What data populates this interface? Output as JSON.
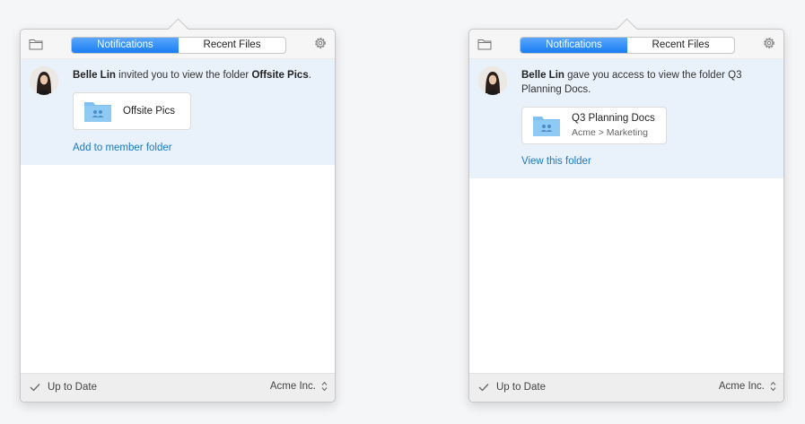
{
  "panels": [
    {
      "tabs": {
        "notifications": "Notifications",
        "recent_files": "Recent Files"
      },
      "notification": {
        "sender": "Belle Lin",
        "message_pre": " invited you to view the folder ",
        "folder_name": "Offsite Pics",
        "message_post": ".",
        "file_name": "Offsite Pics",
        "action_label": "Add to member folder"
      },
      "status": {
        "text": "Up to Date",
        "team": "Acme Inc."
      }
    },
    {
      "tabs": {
        "notifications": "Notifications",
        "recent_files": "Recent Files"
      },
      "notification": {
        "sender": "Belle Lin",
        "message": " gave you access to view the folder Q3 Planning Docs.",
        "file_name": "Q3 Planning Docs",
        "file_path": "Acme > Marketing",
        "action_label": "View this folder"
      },
      "status": {
        "text": "Up to Date",
        "team": "Acme Inc."
      }
    }
  ],
  "colors": {
    "accent": "#1a7ef5",
    "link": "#1a7ac7",
    "notification_bg": "#e9f1fb",
    "folder_blue": "#7fc0f0"
  }
}
